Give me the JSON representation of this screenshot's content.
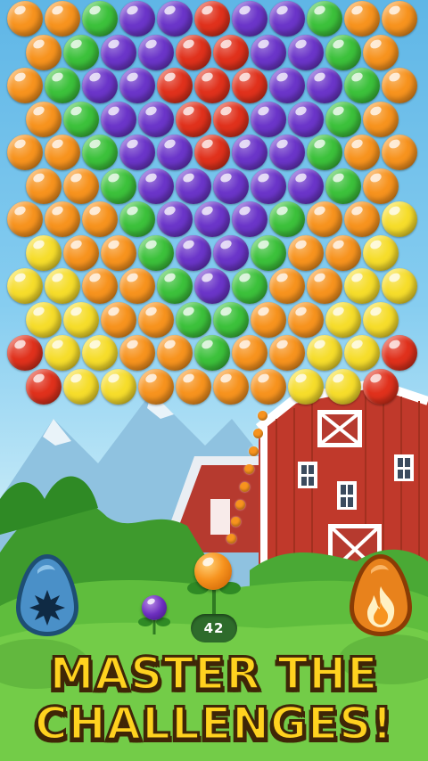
{
  "bubble_grid": {
    "rows": [
      "OOGPPRPPGOO",
      "OGPPRRPPGO",
      "OGPPRRRPPGO",
      "OGPPRRPPGO",
      "OOGPPRPPGOO",
      "OOGPPPPPGO",
      "OOOGPPPGOOY",
      "YOOGPPGOOY",
      "YYOOGPGOOYY",
      "YYOOGGOOYY",
      "RYYOOGOOYYR",
      "RYYOOOOYYR"
    ],
    "colors": {
      "O": "#f7931e",
      "G": "#3cc13b",
      "P": "#6b35c9",
      "R": "#e0311c",
      "Y": "#f6dd2b"
    }
  },
  "shooter": {
    "current_bubble_color": "orange",
    "next_bubble_color": "purple",
    "shots_remaining": "42"
  },
  "powerups": [
    {
      "name": "bomb",
      "icon": "starburst-icon",
      "color": "#4a90c8"
    },
    {
      "name": "fire",
      "icon": "flame-icon",
      "color": "#e8821c"
    }
  ],
  "headline": {
    "line1": "MASTER THE",
    "line2": "CHALLENGES!"
  }
}
